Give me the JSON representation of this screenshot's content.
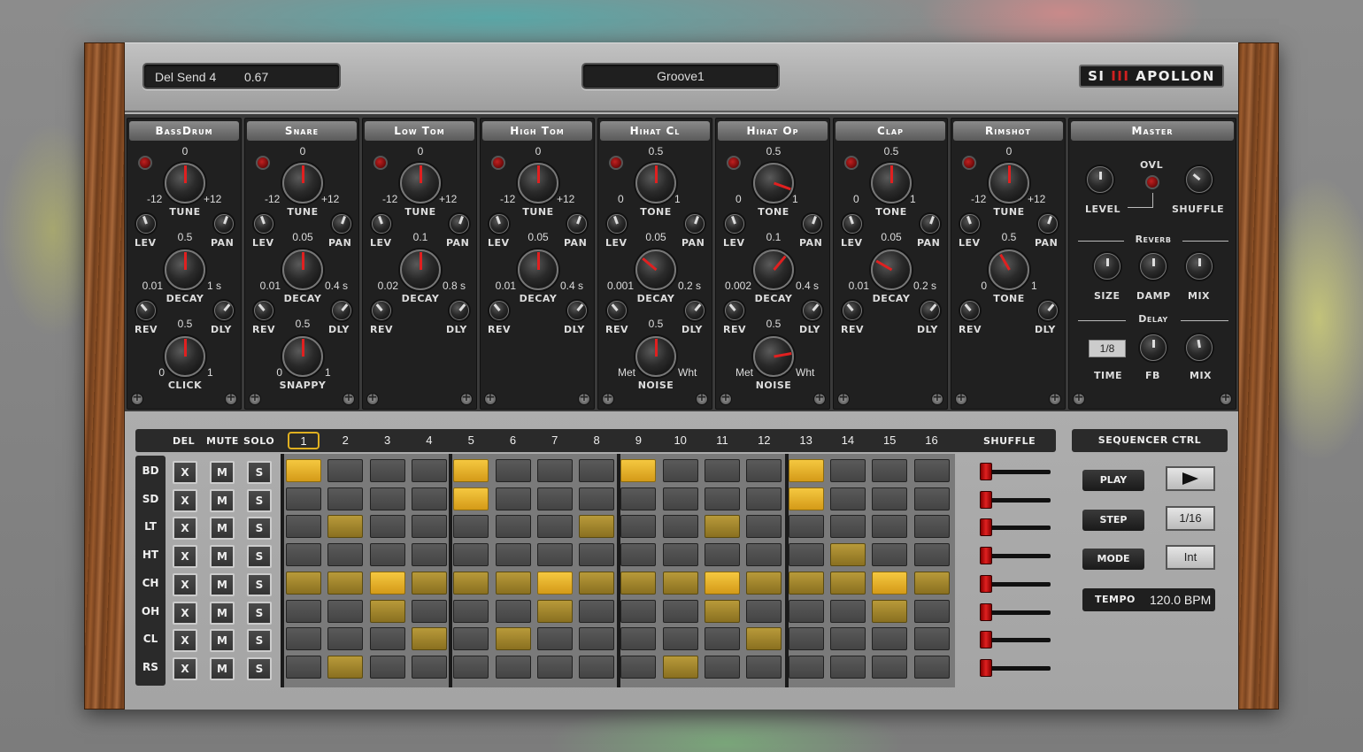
{
  "header": {
    "param_name": "Del Send 4",
    "param_value": "0.67",
    "preset": "Groove1",
    "logo_prefix": "SI",
    "logo_mark": "III",
    "logo_name": "APOLLON"
  },
  "modules": [
    {
      "name": "BassDrum",
      "k1": {
        "top": "0",
        "left": "-12",
        "right": "+12",
        "label": "TUNE",
        "angle": 0
      },
      "k2": {
        "top": "0.5",
        "left": "0.01",
        "right": "1 s",
        "label": "DECAY",
        "angle": 0
      },
      "k3": {
        "top": "0.5",
        "left": "0",
        "right": "1",
        "label": "CLICK",
        "angle": 0
      },
      "lev": "LEV",
      "pan": "PAN",
      "rev": "REV",
      "dly": "DLY"
    },
    {
      "name": "Snare",
      "k1": {
        "top": "0",
        "left": "-12",
        "right": "+12",
        "label": "TUNE",
        "angle": 0
      },
      "k2": {
        "top": "0.05",
        "left": "0.01",
        "right": "0.4 s",
        "label": "DECAY",
        "angle": 0
      },
      "k3": {
        "top": "0.5",
        "left": "0",
        "right": "1",
        "label": "SNAPPY",
        "angle": 0
      },
      "lev": "LEV",
      "pan": "PAN",
      "rev": "REV",
      "dly": "DLY"
    },
    {
      "name": "Low Tom",
      "k1": {
        "top": "0",
        "left": "-12",
        "right": "+12",
        "label": "TUNE",
        "angle": 0
      },
      "k2": {
        "top": "0.1",
        "left": "0.02",
        "right": "0.8 s",
        "label": "DECAY",
        "angle": 0
      },
      "k3": null,
      "lev": "LEV",
      "pan": "PAN",
      "rev": "REV",
      "dly": "DLY"
    },
    {
      "name": "High Tom",
      "k1": {
        "top": "0",
        "left": "-12",
        "right": "+12",
        "label": "TUNE",
        "angle": 0
      },
      "k2": {
        "top": "0.05",
        "left": "0.01",
        "right": "0.4 s",
        "label": "DECAY",
        "angle": 0
      },
      "k3": null,
      "lev": "LEV",
      "pan": "PAN",
      "rev": "REV",
      "dly": "DLY"
    },
    {
      "name": "Hihat Cl",
      "k1": {
        "top": "0.5",
        "left": "0",
        "right": "1",
        "label": "TONE",
        "angle": 0
      },
      "k2": {
        "top": "0.05",
        "left": "0.001",
        "right": "0.2 s",
        "label": "DECAY",
        "angle": -50
      },
      "k3": {
        "top": "0.5",
        "left": "Met",
        "right": "Wht",
        "label": "NOISE",
        "angle": 0
      },
      "lev": "LEV",
      "pan": "PAN",
      "rev": "REV",
      "dly": "DLY"
    },
    {
      "name": "Hihat Op",
      "k1": {
        "top": "0.5",
        "left": "0",
        "right": "1",
        "label": "TONE",
        "angle": 110
      },
      "k2": {
        "top": "0.1",
        "left": "0.002",
        "right": "0.4 s",
        "label": "DECAY",
        "angle": 40
      },
      "k3": {
        "top": "0.5",
        "left": "Met",
        "right": "Wht",
        "label": "NOISE",
        "angle": 80
      },
      "lev": "LEV",
      "pan": "PAN",
      "rev": "REV",
      "dly": "DLY"
    },
    {
      "name": "Clap",
      "k1": {
        "top": "0.5",
        "left": "0",
        "right": "1",
        "label": "TONE",
        "angle": 0
      },
      "k2": {
        "top": "0.05",
        "left": "0.01",
        "right": "0.2 s",
        "label": "DECAY",
        "angle": -60
      },
      "k3": null,
      "lev": "LEV",
      "pan": "PAN",
      "rev": "REV",
      "dly": "DLY"
    },
    {
      "name": "Rimshot",
      "k1": {
        "top": "0",
        "left": "-12",
        "right": "+12",
        "label": "TUNE",
        "angle": 0
      },
      "k2": {
        "top": "0.5",
        "left": "0",
        "right": "1",
        "label": "TONE",
        "angle": -30
      },
      "k3": null,
      "lev": "LEV",
      "pan": "PAN",
      "rev": "REV",
      "dly": "DLY"
    }
  ],
  "master": {
    "title": "Master",
    "level": "LEVEL",
    "ovl": "OVL",
    "shuffle": "SHUFFLE",
    "reverb": "Reverb",
    "size": "SIZE",
    "damp": "DAMP",
    "mix": "MIX",
    "delay": "Delay",
    "time_value": "1/8",
    "time": "TIME",
    "fb": "FB",
    "mix2": "MIX"
  },
  "sequencer": {
    "headers": {
      "del": "DEL",
      "mute": "MUTE",
      "solo": "SOLO",
      "shuffle": "SHUFFLE"
    },
    "steps": [
      "1",
      "2",
      "3",
      "4",
      "5",
      "6",
      "7",
      "8",
      "9",
      "10",
      "11",
      "12",
      "13",
      "14",
      "15",
      "16"
    ],
    "current_step": "1",
    "rows": [
      {
        "name": "BD",
        "del": "X",
        "mute": "M",
        "solo": "S",
        "pattern": [
          2,
          0,
          0,
          0,
          2,
          0,
          0,
          0,
          2,
          0,
          0,
          0,
          2,
          0,
          0,
          0
        ]
      },
      {
        "name": "SD",
        "del": "X",
        "mute": "M",
        "solo": "S",
        "pattern": [
          0,
          0,
          0,
          0,
          2,
          0,
          0,
          0,
          0,
          0,
          0,
          0,
          2,
          0,
          0,
          0
        ]
      },
      {
        "name": "LT",
        "del": "X",
        "mute": "M",
        "solo": "S",
        "pattern": [
          0,
          1,
          0,
          0,
          0,
          0,
          0,
          1,
          0,
          0,
          1,
          0,
          0,
          0,
          0,
          0
        ]
      },
      {
        "name": "HT",
        "del": "X",
        "mute": "M",
        "solo": "S",
        "pattern": [
          0,
          0,
          0,
          0,
          0,
          0,
          0,
          0,
          0,
          0,
          0,
          0,
          0,
          1,
          0,
          0
        ]
      },
      {
        "name": "CH",
        "del": "X",
        "mute": "M",
        "solo": "S",
        "pattern": [
          1,
          1,
          2,
          1,
          1,
          1,
          2,
          1,
          1,
          1,
          2,
          1,
          1,
          1,
          2,
          1
        ]
      },
      {
        "name": "OH",
        "del": "X",
        "mute": "M",
        "solo": "S",
        "pattern": [
          0,
          0,
          1,
          0,
          0,
          0,
          1,
          0,
          0,
          0,
          1,
          0,
          0,
          0,
          1,
          0
        ]
      },
      {
        "name": "CL",
        "del": "X",
        "mute": "M",
        "solo": "S",
        "pattern": [
          0,
          0,
          0,
          1,
          0,
          1,
          0,
          0,
          0,
          0,
          0,
          1,
          0,
          0,
          0,
          0
        ]
      },
      {
        "name": "RS",
        "del": "X",
        "mute": "M",
        "solo": "S",
        "pattern": [
          0,
          1,
          0,
          0,
          0,
          0,
          0,
          0,
          0,
          1,
          0,
          0,
          0,
          0,
          0,
          0
        ]
      }
    ]
  },
  "seq_ctrl": {
    "title": "SEQUENCER CTRL",
    "play": "PLAY",
    "step": "STEP",
    "step_value": "1/16",
    "mode": "MODE",
    "mode_value": "Int",
    "tempo_label": "TEMPO",
    "tempo_value": "120.0 BPM"
  },
  "colors": {
    "step_on": "#f5c840",
    "step_accent": "#b89a3a",
    "led": "#c02020",
    "panel": "#202020"
  }
}
